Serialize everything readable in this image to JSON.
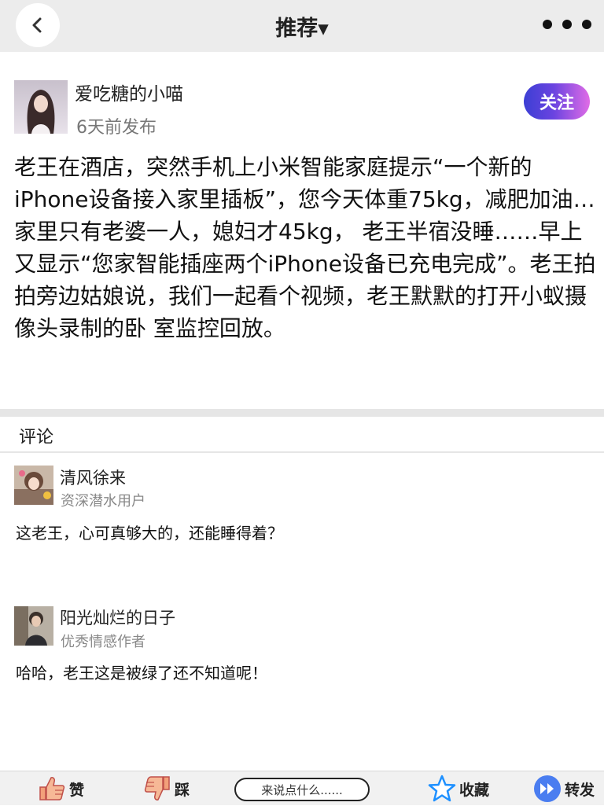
{
  "header": {
    "title": "推荐▾"
  },
  "post": {
    "author_name": "爱吃糖的小喵",
    "time": "6天前发布",
    "follow_label": "关注",
    "body": "老王在酒店，突然手机上小米智能家庭提示“一个新的iPhone设备接入家里插板”，您今天体重75kg，减肥加油…家里只有老婆一人，媳妇才45kg，  老王半宿没睡……早上又显示“您家智能插座两个iPhone设备已充电完成”。老王拍拍旁边姑娘说，我们一起看个视频，老王默默的打开小蚁摄像头录制的卧 室监控回放。"
  },
  "comments": {
    "title": "评论",
    "items": [
      {
        "name": "清风徐来",
        "role": "资深潜水用户",
        "text": "这老王，心可真够大的，还能睡得着？"
      },
      {
        "name": "阳光灿烂的日子",
        "role": "优秀情感作者",
        "text": "哈哈，老王这是被绿了还不知道呢！"
      }
    ]
  },
  "bottom_bar": {
    "like_label": "赞",
    "dislike_label": "踩",
    "input_placeholder": "来说点什么......",
    "favorite_label": "收藏",
    "share_label": "转发"
  },
  "icons": {
    "back": "chevron-left-icon",
    "more": "more-dots-icon",
    "like": "thumbs-up-icon",
    "dislike": "thumbs-down-icon",
    "favorite": "star-icon",
    "share": "forward-icon"
  },
  "colors": {
    "top_bar": "#ececec",
    "follow_gradient_start": "#3c3fd4",
    "follow_gradient_end": "#e06ce6",
    "star": "#1e90ff",
    "share": "#4a7df0",
    "thumb": "#f2a07a"
  }
}
